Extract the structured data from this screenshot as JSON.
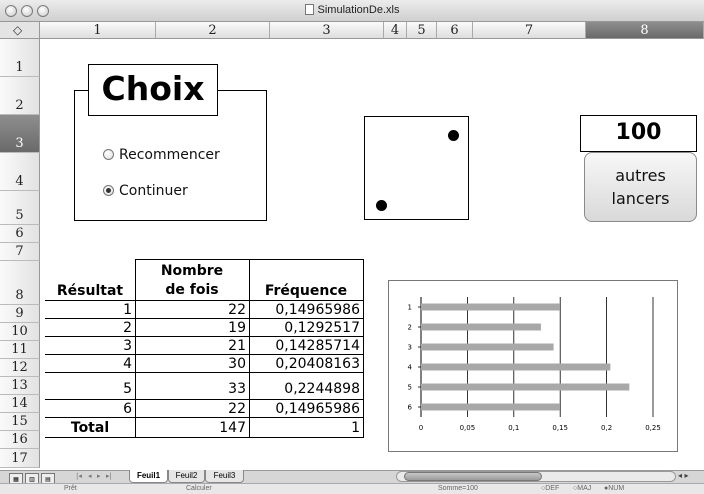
{
  "window": {
    "title": "SimulationDe.xls"
  },
  "column_headers": [
    "1",
    "2",
    "3",
    "4",
    "5",
    "6",
    "7",
    "8"
  ],
  "selected_column": "8",
  "row_headers": [
    "1",
    "2",
    "3",
    "4",
    "5",
    "6",
    "7",
    "8",
    "9",
    "10",
    "11",
    "12",
    "13",
    "14",
    "15",
    "16",
    "17"
  ],
  "selected_row": "3",
  "choix": {
    "title": "Choix",
    "options": [
      {
        "label": "Recommencer",
        "selected": false
      },
      {
        "label": "Continuer",
        "selected": true
      }
    ]
  },
  "die": {
    "face": 2
  },
  "count": "100",
  "relaunch_button": {
    "line1": "autres",
    "line2": "lancers"
  },
  "table": {
    "headers": {
      "result": "Résultat",
      "count_line1": "Nombre",
      "count_line2": "de fois",
      "frequency": "Fréquence"
    },
    "rows": [
      {
        "result": "1",
        "count": "22",
        "frequency": "0,14965986"
      },
      {
        "result": "2",
        "count": "19",
        "frequency": "0,1292517"
      },
      {
        "result": "3",
        "count": "21",
        "frequency": "0,14285714"
      },
      {
        "result": "4",
        "count": "30",
        "frequency": "0,20408163"
      },
      {
        "result": "5",
        "count": "33",
        "frequency": "0,2244898"
      },
      {
        "result": "6",
        "count": "22",
        "frequency": "0,14965986"
      }
    ],
    "total": {
      "label": "Total",
      "count": "147",
      "frequency": "1"
    }
  },
  "chart_data": {
    "type": "bar",
    "orientation": "horizontal",
    "categories": [
      "1",
      "2",
      "3",
      "4",
      "5",
      "6"
    ],
    "values": [
      0.14965986,
      0.1292517,
      0.14285714,
      0.20408163,
      0.2244898,
      0.14965986
    ],
    "xlim": [
      0,
      0.25
    ],
    "x_ticks": [
      "0",
      "0,05",
      "0,1",
      "0,15",
      "0,2",
      "0,25"
    ],
    "grid": "vertical",
    "legend": "none",
    "bar_color": "#a8a8a8"
  },
  "sheets": {
    "tabs": [
      "Feuil1",
      "Feuil2",
      "Feuil3"
    ],
    "active": "Feuil1"
  },
  "status": {
    "ready": "Prêt",
    "mode": "Calculer",
    "sum": "Somme=100",
    "indicators": [
      "DEF",
      "MAJ",
      "NUM"
    ]
  }
}
